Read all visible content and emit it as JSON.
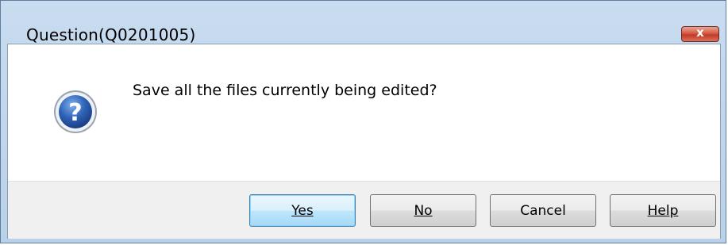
{
  "window": {
    "title": "Question(Q0201005)",
    "close_glyph": "x"
  },
  "dialog": {
    "icon": "question-icon",
    "message": "Save all the files currently being edited?"
  },
  "buttons": {
    "yes": "Yes",
    "no": "No",
    "cancel": "Cancel",
    "help": "Help"
  },
  "colors": {
    "title_bar": "#c4d9ef",
    "icon_blue": "#2e63b5",
    "default_button_border": "#3c7fb1",
    "close_button": "#c8442e"
  }
}
